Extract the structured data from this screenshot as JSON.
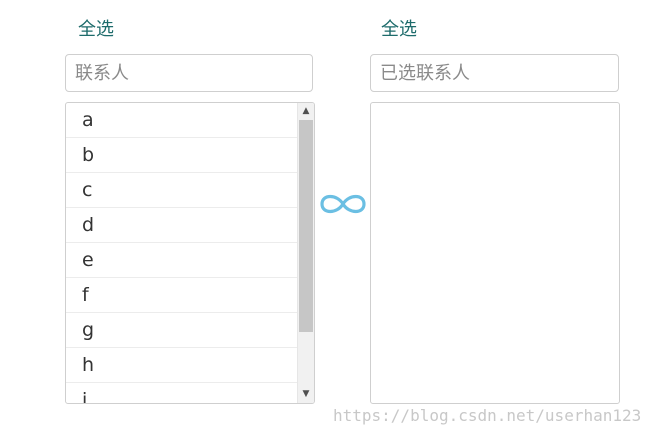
{
  "left_panel": {
    "select_all_label": "全选",
    "search_placeholder": "联系人",
    "items": [
      "a",
      "b",
      "c",
      "d",
      "e",
      "f",
      "g",
      "h"
    ]
  },
  "right_panel": {
    "select_all_label": "全选",
    "search_placeholder": "已选联系人",
    "items": []
  },
  "swap_icon": "infinity-icon",
  "accent_color": "#1d6b6b",
  "watermark": "https://blog.csdn.net/userhan123"
}
